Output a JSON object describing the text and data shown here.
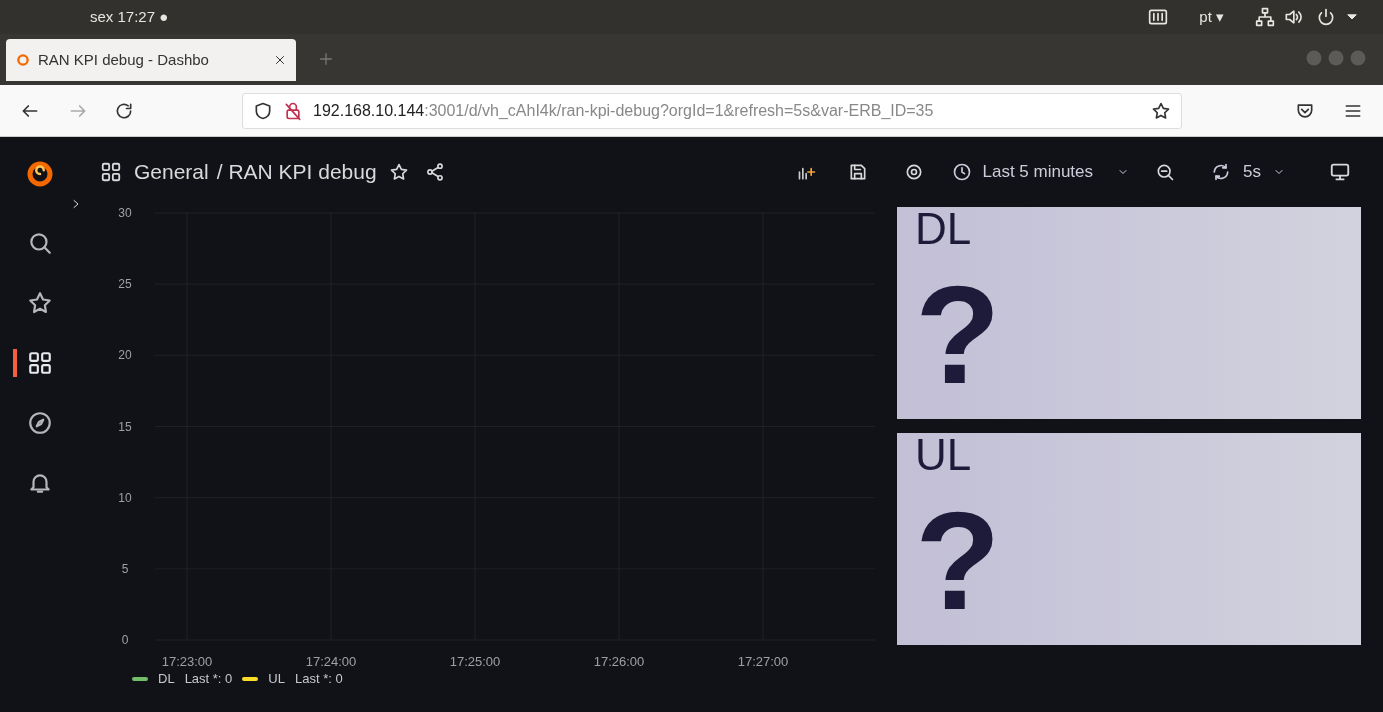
{
  "system_bar": {
    "clock": "sex 17:27 ●",
    "keyboard_layout": "pt ▾"
  },
  "browser": {
    "tabs": [
      {
        "title": "RAN KPI debug - Dashbo",
        "selected": true
      }
    ],
    "url": {
      "host": "192.168.10.144",
      "path": ":3001/d/vh_cAhI4k/ran-kpi-debug?orgId=1&refresh=5s&var-ERB_ID=35"
    }
  },
  "sidebar": {
    "items": [
      {
        "kind": "search",
        "selected": false
      },
      {
        "kind": "star",
        "selected": false
      },
      {
        "kind": "dashboards",
        "selected": true
      },
      {
        "kind": "explore",
        "selected": false
      },
      {
        "kind": "alerting",
        "selected": false
      }
    ]
  },
  "header": {
    "folder": "General",
    "title": "/ RAN KPI debug",
    "time_range": "Last 5 minutes",
    "refresh": "5s"
  },
  "graph_panel": {
    "chart_data": {
      "type": "line",
      "grid": true,
      "x": [
        "17:23:00",
        "17:24:00",
        "17:25:00",
        "17:26:00",
        "17:27:00"
      ],
      "yticks": [
        0,
        5,
        10,
        15,
        20,
        25,
        30
      ],
      "ylim": [
        0,
        30
      ],
      "series": [
        {
          "name": "DL",
          "color": "#73bf69",
          "values": [
            null,
            null,
            null,
            null,
            null
          ]
        },
        {
          "name": "UL",
          "color": "#fade2a",
          "values": [
            null,
            null,
            null,
            null,
            null
          ]
        }
      ]
    },
    "legend": [
      {
        "reading": "Last *: 0"
      },
      {
        "reading": "Last *: 0"
      }
    ]
  },
  "stat_panels": [
    {
      "title": "DL",
      "value": "?"
    },
    {
      "title": "UL",
      "value": "?"
    }
  ]
}
